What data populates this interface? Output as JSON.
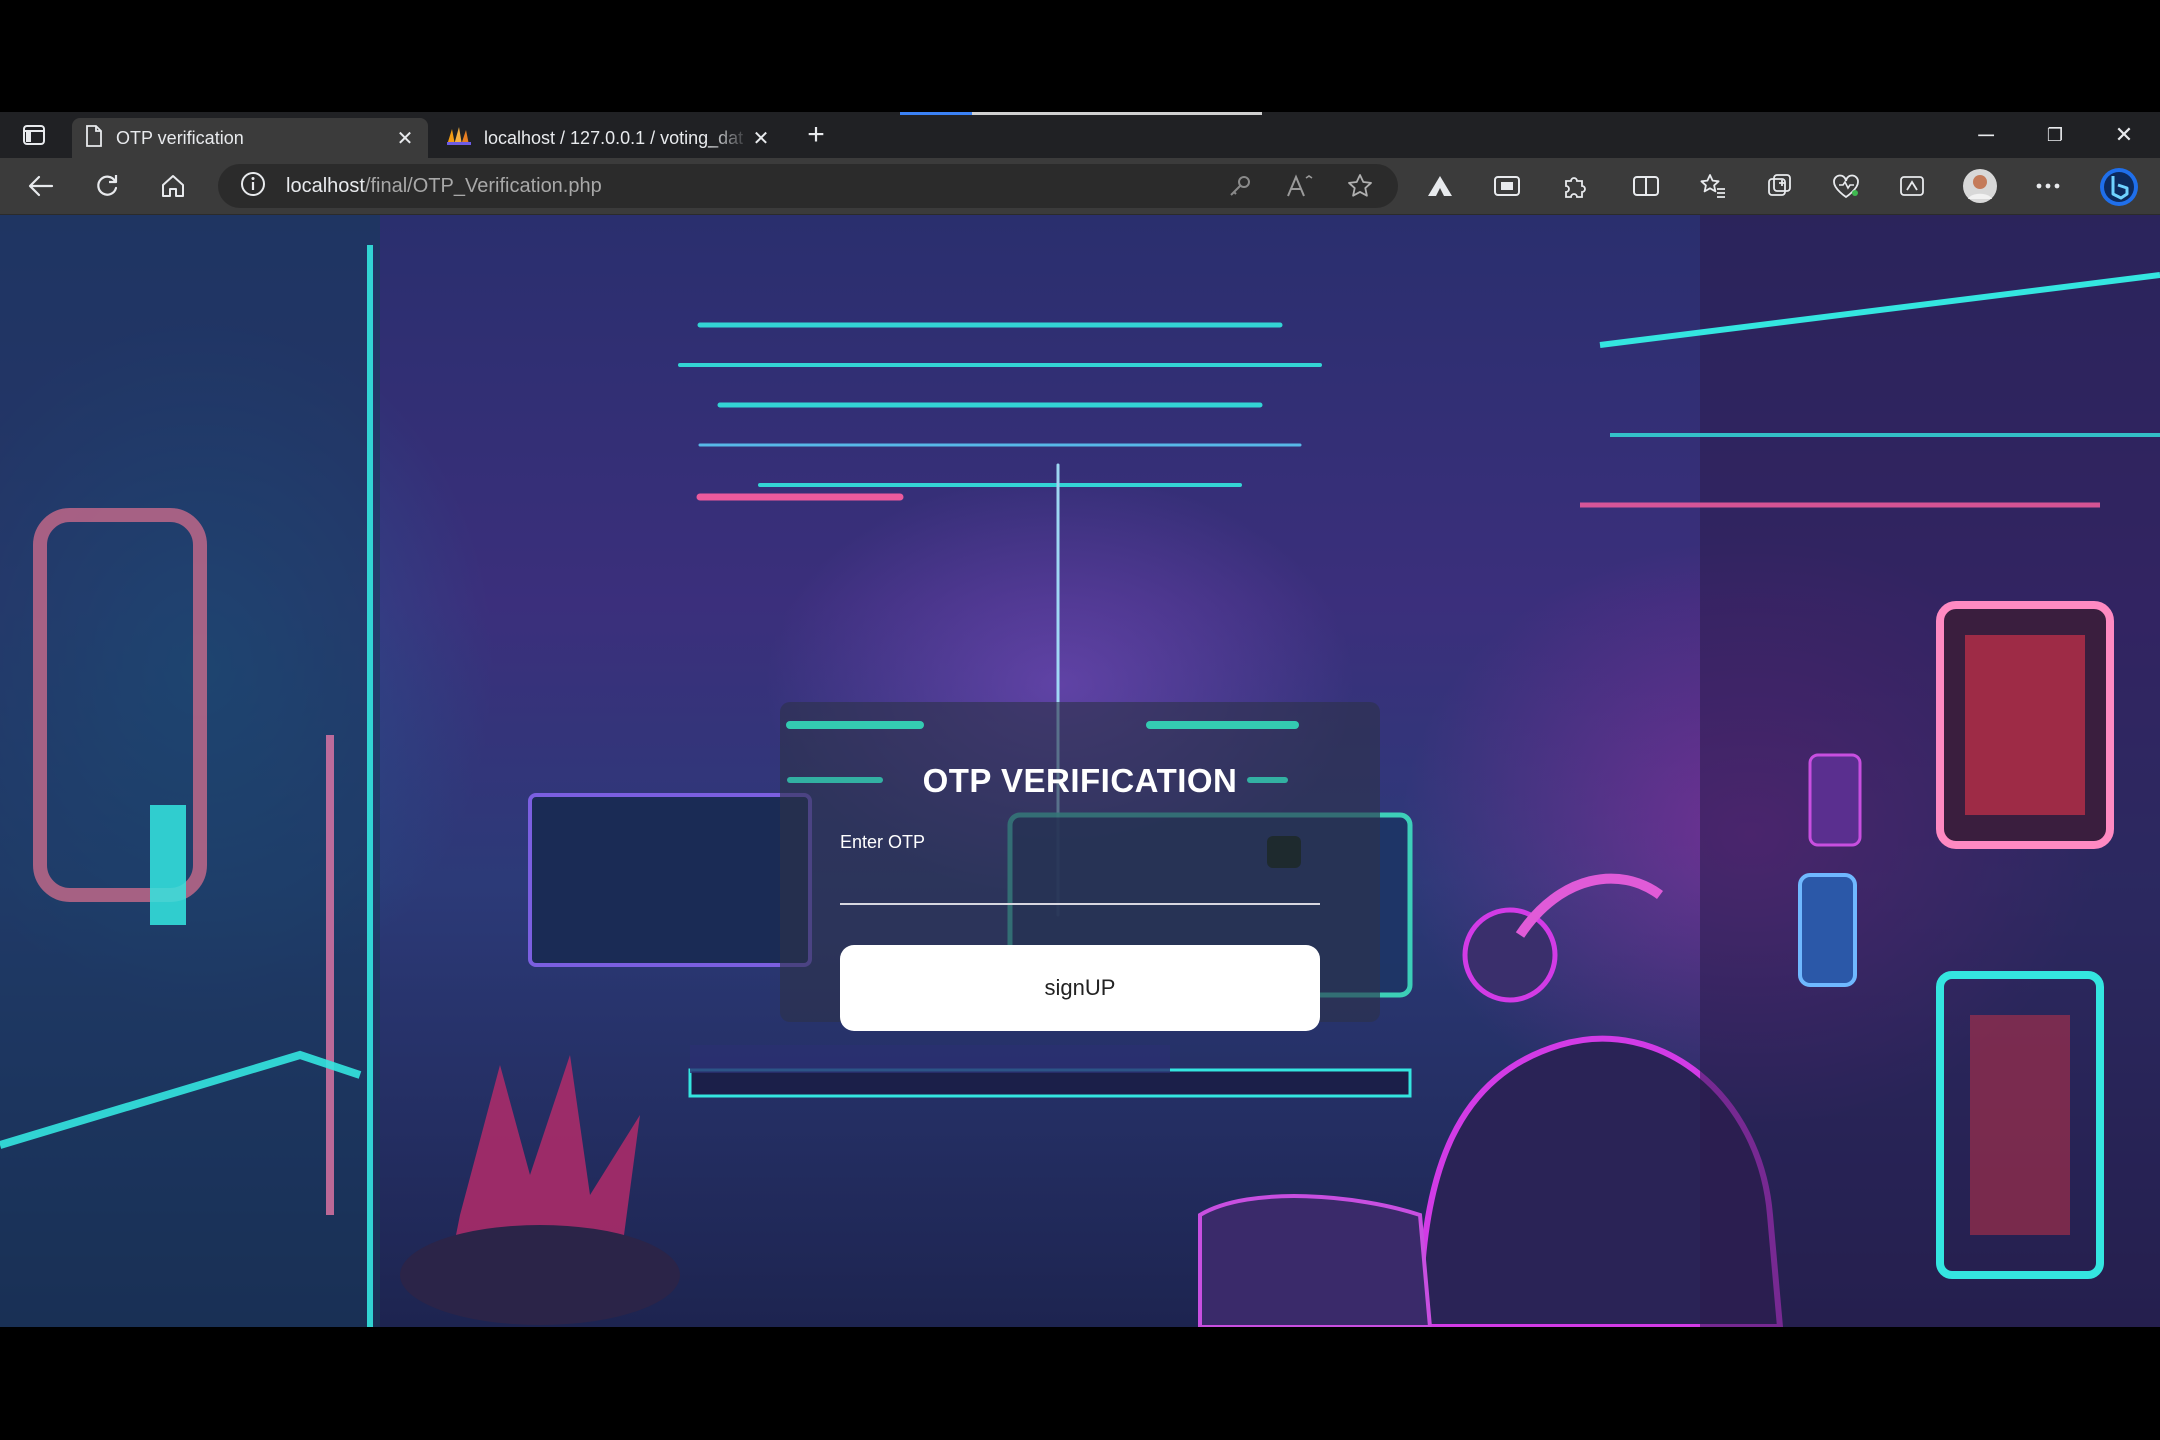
{
  "browser": {
    "tabs": [
      {
        "title": "OTP verification",
        "active": true,
        "icon": "document-icon"
      },
      {
        "title": "localhost / 127.0.0.1 / voting_dat",
        "active": false,
        "icon": "phpmyadmin-icon"
      }
    ],
    "new_tab_glyph": "+",
    "address": {
      "host": "localhost",
      "path": "/final/OTP_Verification.php"
    },
    "window_controls": {
      "minimize": "─",
      "restore": "❐",
      "close": "✕"
    }
  },
  "page": {
    "card": {
      "title": "OTP VERIFICATION",
      "otp_label": "Enter OTP",
      "otp_value": "",
      "submit_label": "signUP"
    }
  },
  "colors": {
    "tab_bg": "#202124",
    "toolbar_bg": "#3b3b3b",
    "accent_neon_cyan": "#34e6e0",
    "accent_neon_magenta": "#d23be6",
    "button_bg": "#ffffff"
  }
}
